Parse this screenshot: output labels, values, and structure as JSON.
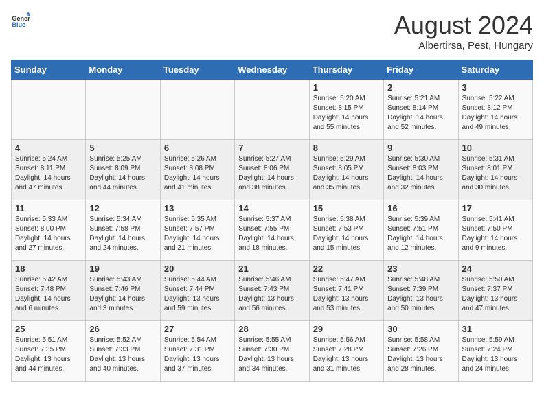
{
  "header": {
    "logo_general": "General",
    "logo_blue": "Blue",
    "month_year": "August 2024",
    "location": "Albertirsa, Pest, Hungary"
  },
  "weekdays": [
    "Sunday",
    "Monday",
    "Tuesday",
    "Wednesday",
    "Thursday",
    "Friday",
    "Saturday"
  ],
  "weeks": [
    [
      {
        "day": "",
        "info": ""
      },
      {
        "day": "",
        "info": ""
      },
      {
        "day": "",
        "info": ""
      },
      {
        "day": "",
        "info": ""
      },
      {
        "day": "1",
        "info": "Sunrise: 5:20 AM\nSunset: 8:15 PM\nDaylight: 14 hours\nand 55 minutes."
      },
      {
        "day": "2",
        "info": "Sunrise: 5:21 AM\nSunset: 8:14 PM\nDaylight: 14 hours\nand 52 minutes."
      },
      {
        "day": "3",
        "info": "Sunrise: 5:22 AM\nSunset: 8:12 PM\nDaylight: 14 hours\nand 49 minutes."
      }
    ],
    [
      {
        "day": "4",
        "info": "Sunrise: 5:24 AM\nSunset: 8:11 PM\nDaylight: 14 hours\nand 47 minutes."
      },
      {
        "day": "5",
        "info": "Sunrise: 5:25 AM\nSunset: 8:09 PM\nDaylight: 14 hours\nand 44 minutes."
      },
      {
        "day": "6",
        "info": "Sunrise: 5:26 AM\nSunset: 8:08 PM\nDaylight: 14 hours\nand 41 minutes."
      },
      {
        "day": "7",
        "info": "Sunrise: 5:27 AM\nSunset: 8:06 PM\nDaylight: 14 hours\nand 38 minutes."
      },
      {
        "day": "8",
        "info": "Sunrise: 5:29 AM\nSunset: 8:05 PM\nDaylight: 14 hours\nand 35 minutes."
      },
      {
        "day": "9",
        "info": "Sunrise: 5:30 AM\nSunset: 8:03 PM\nDaylight: 14 hours\nand 32 minutes."
      },
      {
        "day": "10",
        "info": "Sunrise: 5:31 AM\nSunset: 8:01 PM\nDaylight: 14 hours\nand 30 minutes."
      }
    ],
    [
      {
        "day": "11",
        "info": "Sunrise: 5:33 AM\nSunset: 8:00 PM\nDaylight: 14 hours\nand 27 minutes."
      },
      {
        "day": "12",
        "info": "Sunrise: 5:34 AM\nSunset: 7:58 PM\nDaylight: 14 hours\nand 24 minutes."
      },
      {
        "day": "13",
        "info": "Sunrise: 5:35 AM\nSunset: 7:57 PM\nDaylight: 14 hours\nand 21 minutes."
      },
      {
        "day": "14",
        "info": "Sunrise: 5:37 AM\nSunset: 7:55 PM\nDaylight: 14 hours\nand 18 minutes."
      },
      {
        "day": "15",
        "info": "Sunrise: 5:38 AM\nSunset: 7:53 PM\nDaylight: 14 hours\nand 15 minutes."
      },
      {
        "day": "16",
        "info": "Sunrise: 5:39 AM\nSunset: 7:51 PM\nDaylight: 14 hours\nand 12 minutes."
      },
      {
        "day": "17",
        "info": "Sunrise: 5:41 AM\nSunset: 7:50 PM\nDaylight: 14 hours\nand 9 minutes."
      }
    ],
    [
      {
        "day": "18",
        "info": "Sunrise: 5:42 AM\nSunset: 7:48 PM\nDaylight: 14 hours\nand 6 minutes."
      },
      {
        "day": "19",
        "info": "Sunrise: 5:43 AM\nSunset: 7:46 PM\nDaylight: 14 hours\nand 3 minutes."
      },
      {
        "day": "20",
        "info": "Sunrise: 5:44 AM\nSunset: 7:44 PM\nDaylight: 13 hours\nand 59 minutes."
      },
      {
        "day": "21",
        "info": "Sunrise: 5:46 AM\nSunset: 7:43 PM\nDaylight: 13 hours\nand 56 minutes."
      },
      {
        "day": "22",
        "info": "Sunrise: 5:47 AM\nSunset: 7:41 PM\nDaylight: 13 hours\nand 53 minutes."
      },
      {
        "day": "23",
        "info": "Sunrise: 5:48 AM\nSunset: 7:39 PM\nDaylight: 13 hours\nand 50 minutes."
      },
      {
        "day": "24",
        "info": "Sunrise: 5:50 AM\nSunset: 7:37 PM\nDaylight: 13 hours\nand 47 minutes."
      }
    ],
    [
      {
        "day": "25",
        "info": "Sunrise: 5:51 AM\nSunset: 7:35 PM\nDaylight: 13 hours\nand 44 minutes."
      },
      {
        "day": "26",
        "info": "Sunrise: 5:52 AM\nSunset: 7:33 PM\nDaylight: 13 hours\nand 40 minutes."
      },
      {
        "day": "27",
        "info": "Sunrise: 5:54 AM\nSunset: 7:31 PM\nDaylight: 13 hours\nand 37 minutes."
      },
      {
        "day": "28",
        "info": "Sunrise: 5:55 AM\nSunset: 7:30 PM\nDaylight: 13 hours\nand 34 minutes."
      },
      {
        "day": "29",
        "info": "Sunrise: 5:56 AM\nSunset: 7:28 PM\nDaylight: 13 hours\nand 31 minutes."
      },
      {
        "day": "30",
        "info": "Sunrise: 5:58 AM\nSunset: 7:26 PM\nDaylight: 13 hours\nand 28 minutes."
      },
      {
        "day": "31",
        "info": "Sunrise: 5:59 AM\nSunset: 7:24 PM\nDaylight: 13 hours\nand 24 minutes."
      }
    ]
  ]
}
